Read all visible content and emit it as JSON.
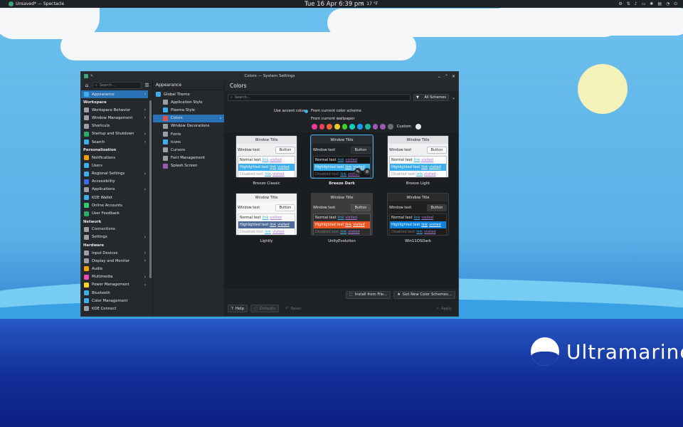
{
  "panel": {
    "app_title": "Unsaved* — Spectacle",
    "clock": "Tue 16 Apr  6:39 pm",
    "weather": "☾  17 °F",
    "tray_icons": [
      "gear-icon",
      "network-icon",
      "volume-icon",
      "battery-icon",
      "bluetooth-icon",
      "clipboard-icon",
      "notifications-icon",
      "power-icon"
    ]
  },
  "window": {
    "title": "Colors — System Settings",
    "search_placeholder": "Search...",
    "sidebar": {
      "items": [
        {
          "type": "item",
          "label": "Appearance",
          "icon": "appearance-icon",
          "color": "#3daee9",
          "arrow": true,
          "active": true
        },
        {
          "type": "section",
          "label": "Workspace"
        },
        {
          "type": "item",
          "label": "Workspace Behavior",
          "icon": "workspace-icon",
          "color": "#9aa0a6",
          "arrow": true
        },
        {
          "type": "item",
          "label": "Window Management",
          "icon": "window-icon",
          "color": "#9aa0a6",
          "arrow": true
        },
        {
          "type": "item",
          "label": "Shortcuts",
          "icon": "keyboard-icon",
          "color": "#9aa0a6"
        },
        {
          "type": "item",
          "label": "Startup and Shutdown",
          "icon": "power-icon",
          "color": "#27ae60",
          "arrow": true
        },
        {
          "type": "item",
          "label": "Search",
          "icon": "search-icon",
          "color": "#3daee9",
          "arrow": true
        },
        {
          "type": "section",
          "label": "Personalization"
        },
        {
          "type": "item",
          "label": "Notifications",
          "icon": "bell-icon",
          "color": "#f0a00c"
        },
        {
          "type": "item",
          "label": "Users",
          "icon": "user-icon",
          "color": "#3daee9"
        },
        {
          "type": "item",
          "label": "Regional Settings",
          "icon": "flag-icon",
          "color": "#3daee9",
          "arrow": true
        },
        {
          "type": "item",
          "label": "Accessibility",
          "icon": "accessibility-icon",
          "color": "#3d6ee9"
        },
        {
          "type": "item",
          "label": "Applications",
          "icon": "apps-icon",
          "color": "#9aa0a6",
          "arrow": true
        },
        {
          "type": "item",
          "label": "KDE Wallet",
          "icon": "wallet-icon",
          "color": "#3daee9"
        },
        {
          "type": "item",
          "label": "Online Accounts",
          "icon": "globe-icon",
          "color": "#2ecc71"
        },
        {
          "type": "item",
          "label": "User Feedback",
          "icon": "feedback-icon",
          "color": "#27ae60"
        },
        {
          "type": "section",
          "label": "Network"
        },
        {
          "type": "item",
          "label": "Connections",
          "icon": "connections-icon",
          "color": "#9aa0a6"
        },
        {
          "type": "item",
          "label": "Settings",
          "icon": "network-settings-icon",
          "color": "#9aa0a6",
          "arrow": true
        },
        {
          "type": "section",
          "label": "Hardware"
        },
        {
          "type": "item",
          "label": "Input Devices",
          "icon": "keyboard-icon",
          "color": "#9aa0a6",
          "arrow": true
        },
        {
          "type": "item",
          "label": "Display and Monitor",
          "icon": "monitor-icon",
          "color": "#9aa0a6",
          "arrow": true
        },
        {
          "type": "item",
          "label": "Audio",
          "icon": "speaker-icon",
          "color": "#f0a00c"
        },
        {
          "type": "item",
          "label": "Multimedia",
          "icon": "multimedia-icon",
          "color": "#e94eb1",
          "arrow": true
        },
        {
          "type": "item",
          "label": "Power Management",
          "icon": "battery-icon",
          "color": "#f6d32d",
          "arrow": true
        },
        {
          "type": "item",
          "label": "Bluetooth",
          "icon": "bluetooth-icon",
          "color": "#3daee9"
        },
        {
          "type": "item",
          "label": "Color Management",
          "icon": "color-mgmt-icon",
          "color": "#3daee9"
        },
        {
          "type": "item",
          "label": "KDE Connect",
          "icon": "phone-icon",
          "color": "#9aa0a6"
        }
      ]
    },
    "subpanel": {
      "title": "Appearance",
      "items": [
        {
          "label": "Global Theme",
          "icon": "global-theme-icon",
          "color": "#3daee9",
          "top": true
        },
        {
          "label": "Application Style",
          "icon": "app-style-icon",
          "color": "#9aa0a6"
        },
        {
          "label": "Plasma Style",
          "icon": "plasma-style-icon",
          "color": "#3daee9"
        },
        {
          "label": "Colors",
          "icon": "colors-icon",
          "color": "#e94e4e",
          "active": true,
          "arrow": true
        },
        {
          "label": "Window Decorations",
          "icon": "window-deco-icon",
          "color": "#9aa0a6"
        },
        {
          "label": "Fonts",
          "icon": "fonts-icon",
          "color": "#9aa0a6"
        },
        {
          "label": "Icons",
          "icon": "icons-icon",
          "color": "#3daee9"
        },
        {
          "label": "Cursors",
          "icon": "cursor-icon",
          "color": "#9aa0a6"
        },
        {
          "label": "Font Management",
          "icon": "font-mgmt-icon",
          "color": "#9aa0a6"
        },
        {
          "label": "Splash Screen",
          "icon": "splash-icon",
          "color": "#9b59b6"
        }
      ]
    },
    "main": {
      "title": "Colors",
      "schemes_label": "All Schemes",
      "accent_label": "Use accent color:",
      "accent_opt1": "From current color scheme",
      "accent_opt2": "From current wallpaper",
      "accent_colors": [
        "#e93a9a",
        "#e93d58",
        "#e9643a",
        "#e8cb2d",
        "#3dd425",
        "#00d3b8",
        "#1d99f3",
        "#1abc9c",
        "#9b59b6",
        "#9b59b6",
        "#6a6e73"
      ],
      "custom_label": "Custom",
      "schemes": [
        {
          "name": "Breeze Classic",
          "title_bg": "#e3e5e7",
          "title_fg": "#232629",
          "win_bg": "#eff0f1",
          "win_fg": "#232629",
          "btn_bg": "#fcfcfc",
          "view_bg": "#fcfcfc",
          "view_border": "#bdc3c7",
          "view_fg": "#232629",
          "hl_bg": "#3daee9",
          "hl_fg": "#fcfcfc",
          "dis_fg": "#a0a2a4",
          "bold": false,
          "selected": false
        },
        {
          "name": "Breeze Dark",
          "title_bg": "#2a2e32",
          "title_fg": "#e6e8ea",
          "win_bg": "#202326",
          "win_fg": "#e6e8ea",
          "btn_bg": "#2b2f33",
          "view_bg": "#141618",
          "view_border": "#3a3e42",
          "view_fg": "#e6e8ea",
          "hl_bg": "#3daee9",
          "hl_fg": "#fcfcfc",
          "dis_fg": "#6e7175",
          "bold": true,
          "selected": true
        },
        {
          "name": "Breeze Light",
          "title_bg": "#dee0e2",
          "title_fg": "#232629",
          "win_bg": "#eff0f1",
          "win_fg": "#232629",
          "btn_bg": "#fcfcfc",
          "view_bg": "#fcfcfc",
          "view_border": "#bdc3c7",
          "view_fg": "#232629",
          "hl_bg": "#3daee9",
          "hl_fg": "#fcfcfc",
          "dis_fg": "#a0a2a4",
          "bold": false,
          "selected": false
        },
        {
          "name": "Lightly",
          "title_bg": "#eff0f1",
          "title_fg": "#232629",
          "win_bg": "#f7f7f8",
          "win_fg": "#232629",
          "btn_bg": "#fcfcfc",
          "view_bg": "#fcfcfc",
          "view_border": "#cfd1d3",
          "view_fg": "#232629",
          "hl_bg": "#4d6a9b",
          "hl_fg": "#fcfcfc",
          "dis_fg": "#a0a2a4",
          "bold": false,
          "selected": false
        },
        {
          "name": "UnityEvolution",
          "title_bg": "#3c3c3c",
          "title_fg": "#e6e8ea",
          "win_bg": "#3c3c3c",
          "win_fg": "#e6e8ea",
          "btn_bg": "#4a4a4a",
          "view_bg": "#2e2e2e",
          "view_border": "#555555",
          "view_fg": "#e6e8ea",
          "hl_bg": "#e95420",
          "hl_fg": "#fcfcfc",
          "dis_fg": "#7a7a7a",
          "bold": false,
          "selected": false
        },
        {
          "name": "Win11OSDark",
          "title_bg": "#2b2b2b",
          "title_fg": "#e6e8ea",
          "win_bg": "#202020",
          "win_fg": "#e6e8ea",
          "btn_bg": "#3a3a3a",
          "view_bg": "#1c1c1c",
          "view_border": "#3a3a3a",
          "view_fg": "#e6e8ea",
          "hl_bg": "#0a84e0",
          "hl_fg": "#fcfcfc",
          "dis_fg": "#7a7a7a",
          "bold": false,
          "selected": false
        }
      ],
      "preview_text": {
        "title": "Window Title",
        "window_text": "Window text",
        "button": "Button",
        "normal": "Normal text",
        "link": "link",
        "visited": "visited",
        "highlighted": "Highlighted text",
        "disabled": "Disabled text"
      },
      "install_label": "Install from File...",
      "get_new_label": "Get New Color Schemes...",
      "help_label": "Help",
      "defaults_label": "Defaults",
      "reset_label": "Reset",
      "apply_label": "Apply"
    }
  },
  "desktop": {
    "brand": "Ultramarine"
  }
}
